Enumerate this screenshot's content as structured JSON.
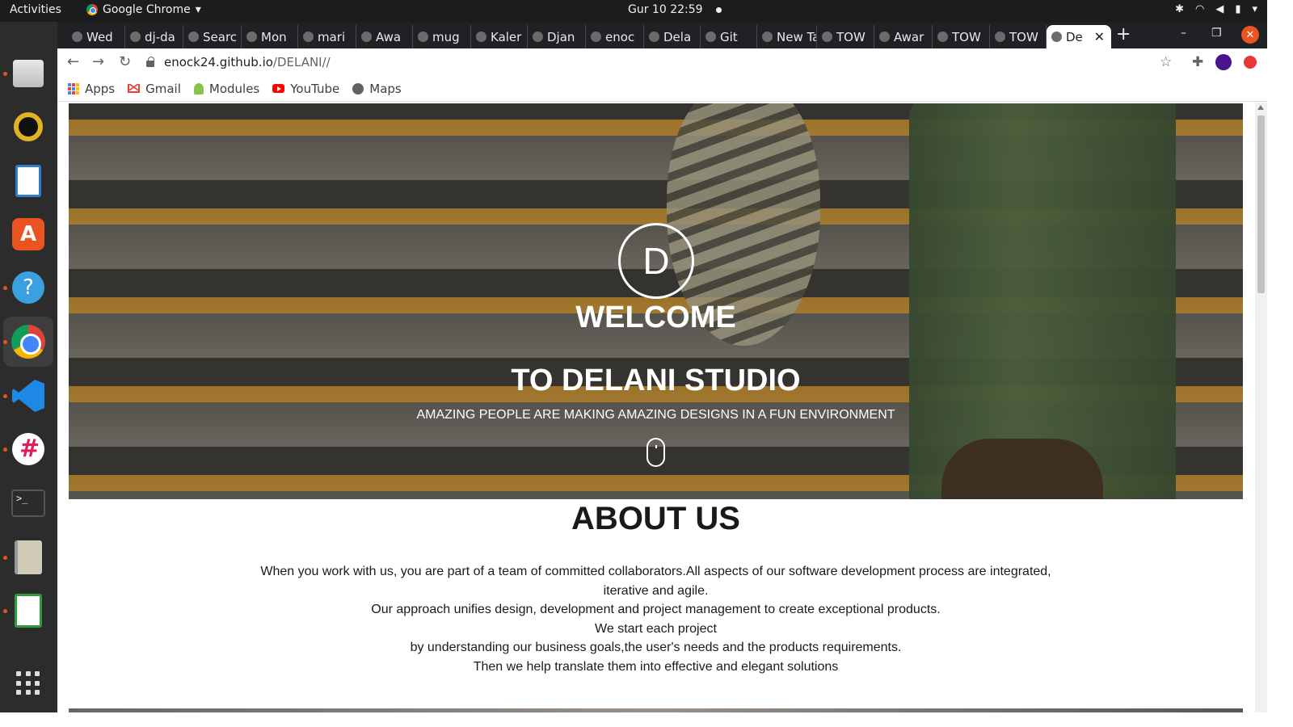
{
  "topbar": {
    "activities": "Activities",
    "app_name": "Google Chrome",
    "clock": "Gur 10  22:59"
  },
  "tabs": [
    {
      "label": "Wed"
    },
    {
      "label": "dj-da"
    },
    {
      "label": "Searc"
    },
    {
      "label": "Mon"
    },
    {
      "label": "mari"
    },
    {
      "label": "Awa"
    },
    {
      "label": "mug"
    },
    {
      "label": "Kaler"
    },
    {
      "label": "Djan"
    },
    {
      "label": "enoc"
    },
    {
      "label": "Dela"
    },
    {
      "label": "Git"
    },
    {
      "label": "New Tab"
    },
    {
      "label": "TOW"
    },
    {
      "label": "Awar"
    },
    {
      "label": "TOW"
    },
    {
      "label": "TOW"
    },
    {
      "label": "De",
      "active": true
    }
  ],
  "toolbar": {
    "url_host": "enock24.github.io",
    "url_path": "/DELANI//"
  },
  "bookmarks": {
    "apps": "Apps",
    "gmail": "Gmail",
    "modules": "Modules",
    "youtube": "YouTube",
    "maps": "Maps"
  },
  "hero": {
    "logo_letter": "D",
    "welcome": "WELCOME",
    "studio": "TO DELANI STUDIO",
    "tagline": "AMAZING PEOPLE ARE MAKING AMAZING DESIGNS IN A FUN ENVIRONMENT"
  },
  "about": {
    "title": "ABOUT US",
    "line1": "When you work with us, you are part of a team of committed collaborators.All aspects of our software development process are integrated, iterative and agile.",
    "line2": "Our approach unifies design, development and project management to create exceptional products.",
    "line3": "We start each project",
    "line4": "by understanding our business goals,the user's needs and the products requirements.",
    "line5": "Then we help translate them into effective and elegant solutions"
  },
  "colors": {
    "accent_ubuntu": "#e95420",
    "chrome_dark": "#202124",
    "hero_orange": "#e3a43a"
  }
}
